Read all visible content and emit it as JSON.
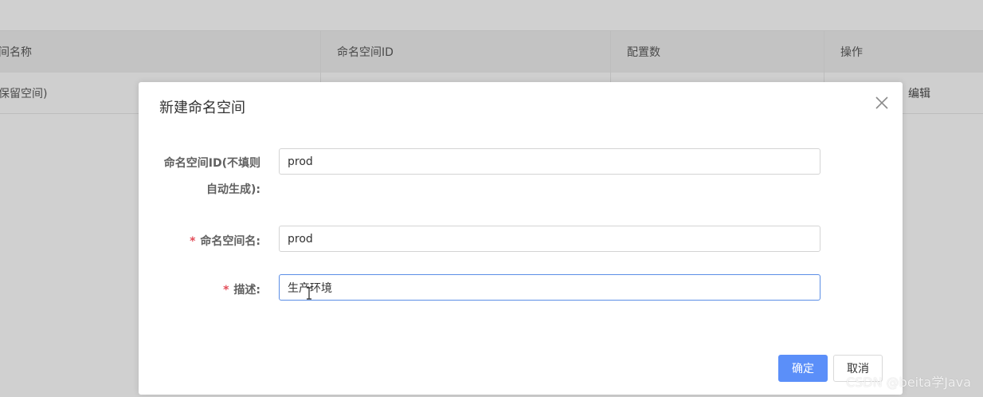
{
  "table": {
    "headers": [
      "间名称",
      "命名空间ID",
      "配置数",
      "操作"
    ],
    "row": {
      "name": "保留空间)",
      "edit": "编辑"
    }
  },
  "modal": {
    "title": "新建命名空间",
    "fields": [
      {
        "label_line1": "命名空间ID(不填则",
        "label_line2": "自动生成):",
        "value": "prod",
        "required": false
      },
      {
        "label": "命名空间名:",
        "value": "prod",
        "required": true
      },
      {
        "label": "描述:",
        "value": "生产环境",
        "required": true
      }
    ],
    "required_mark": "*",
    "confirm_label": "确定",
    "cancel_label": "取消"
  },
  "icons": {
    "close": "close-icon",
    "text_cursor": "text-cursor-icon"
  },
  "colors": {
    "primary": "#5b8ff9",
    "required": "#e34d59",
    "focus_border": "#5b8ee6"
  },
  "watermark": "CSDN @beita学Java"
}
